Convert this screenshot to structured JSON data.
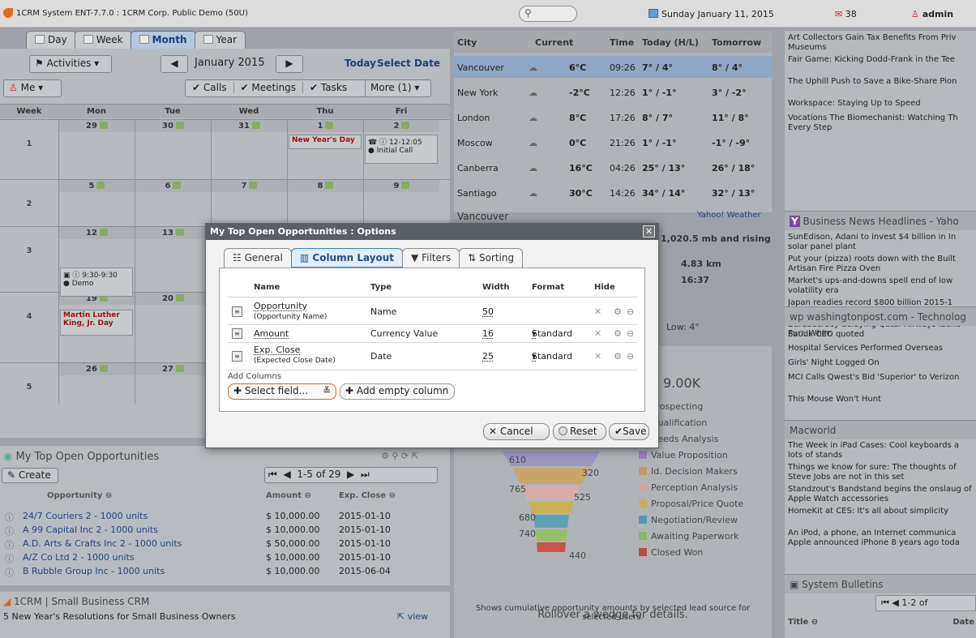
{
  "topbar": {
    "title": "1CRM System ENT-7.7.0 : 1CRM Corp. Public Demo (50U)",
    "date": "Sunday January 11, 2015",
    "mail_count": "38",
    "user": "admin"
  },
  "calendar": {
    "tabs": [
      "Day",
      "Week",
      "Month",
      "Year"
    ],
    "activities_label": "Activities",
    "month_label": "January 2015",
    "today_label": "Today",
    "select_date_label": "Select Date",
    "me_label": "Me",
    "filters": [
      "Calls",
      "Meetings",
      "Tasks"
    ],
    "more_label": "More (1)",
    "headers": [
      "Week",
      "Mon",
      "Tue",
      "Wed",
      "Thu",
      "Fri"
    ],
    "weeks": [
      {
        "num": "1",
        "days": [
          "29",
          "30",
          "31",
          "1",
          "2"
        ]
      },
      {
        "num": "2",
        "days": [
          "5",
          "6",
          "7",
          "8",
          "9"
        ]
      },
      {
        "num": "3",
        "days": [
          "12",
          "13",
          "",
          "",
          ""
        ]
      },
      {
        "num": "4",
        "days": [
          "19",
          "20",
          "",
          "",
          ""
        ]
      },
      {
        "num": "5",
        "days": [
          "26",
          "27",
          "",
          "",
          ""
        ]
      }
    ],
    "events": {
      "new_year": "New Year's Day",
      "call_time": "12-12:05",
      "call_name": "Initial Call",
      "meeting_time": "9:30-9:30",
      "meeting_name": "Demo",
      "mlk": "Martin Luther King, Jr. Day"
    }
  },
  "weather": {
    "headers": [
      "City",
      "Current",
      "Time",
      "Today (H/L)",
      "Tomorrow"
    ],
    "rows": [
      {
        "city": "Vancouver",
        "temp": "6°C",
        "time": "09:26",
        "today": "7° / 4°",
        "tomorrow": "8° / 4°"
      },
      {
        "city": "New York",
        "temp": "-2°C",
        "time": "12:26",
        "today": "1° / -1°",
        "tomorrow": "3° / -2°"
      },
      {
        "city": "London",
        "temp": "8°C",
        "time": "17:26",
        "today": "8° / 7°",
        "tomorrow": "11° / 8°"
      },
      {
        "city": "Moscow",
        "temp": "0°C",
        "time": "21:26",
        "today": "1° / -1°",
        "tomorrow": "-1° / -9°"
      },
      {
        "city": "Canberra",
        "temp": "16°C",
        "time": "04:26",
        "today": "25° / 13°",
        "tomorrow": "26° / 18°"
      },
      {
        "city": "Santiago",
        "temp": "30°C",
        "time": "14:26",
        "today": "34° / 14°",
        "tomorrow": "32° / 13°"
      }
    ],
    "detail_city": "Vancouver",
    "source": "Yahoo! Weather",
    "pressure": "1,020.5 mb and rising",
    "visibility": "4.83 km",
    "sunset": "16:37",
    "low": "Low: 4°"
  },
  "funnel": {
    "total": "9.00K",
    "legend": [
      "Prospecting",
      "Qualification",
      "Needs Analysis",
      "Value Proposition",
      "Id. Decision Makers",
      "Perception Analysis",
      "Proposal/Price Quote",
      "Negotiation/Review",
      "Awaiting Paperwork",
      "Closed Won"
    ],
    "legend_colors": [
      "#b8bcc1",
      "#b8bcc1",
      "#b8bcc1",
      "#9a83b8",
      "#c29a62",
      "#d4a2a2",
      "#c9b04c",
      "#4b9cb0",
      "#8eb85a",
      "#c2483f"
    ],
    "values": [
      "610",
      "320",
      "765",
      "525",
      "680",
      "740",
      "440"
    ],
    "rollover": "Rollover a wedge for details.",
    "caption": "Shows cumulative opportunity amounts by selected lead source for selected users."
  },
  "news": {
    "items_top": [
      "Art Collectors Gain Tax Benefits From Priv Museums",
      "Fair Game: Kicking Dodd-Frank in the Tee",
      "The Uphill Push to Save a Bike-Share Pion",
      "Workspace: Staying Up to Speed",
      "Vocations The Biomechanist: Watching Th Every Step"
    ],
    "business_title": "Business News Headlines - Yaho",
    "business_items": [
      "SunEdison, Adani to invest $4 billion in In solar panel plant",
      "Put your (pizza) roots down with the Built Artisan Fire Pizza Oven",
      "Market's ups-and-downs spell end of low volatility era",
      "Japan readies record $800 billion 2015-1 budget: sources",
      "Bureaucracy delaying Qatar Airways launc Saudi: CEO quoted"
    ],
    "wapo_title": "washingtonpost.com - Technolog",
    "wapo_items": [
      "Purr. Whirr.",
      "Hospital Services Performed Overseas",
      "Girls' Night Logged On",
      "MCI Calls Qwest's Bid 'Superior' to Verizon",
      "This Mouse Won't Hunt"
    ],
    "macworld_title": "Macworld",
    "macworld_items": [
      "The Week in iPad Cases: Cool keyboards a lots of stands",
      "Things we know for sure: The thoughts of Steve Jobs are not in this set",
      "Standzout's Bandstand begins the onslaug of Apple Watch accessories",
      "HomeKit at CES: It's all about simplicity",
      "An iPod, a phone, an Internet communica Apple announced iPhone 8 years ago toda"
    ],
    "bulletins_title": "System Bulletins",
    "bulletins_paging": "1-2 of",
    "bulletins_cols": [
      "Title",
      "Date"
    ]
  },
  "opps": {
    "title": "My Top Open Opportunities",
    "create": "Create",
    "paging": "1-5 of 29",
    "cols": [
      "Opportunity",
      "Amount",
      "Exp. Close"
    ],
    "rows": [
      {
        "name": "24/7 Couriers 2 - 1000 units",
        "amount": "$ 10,000.00",
        "close": "2015-01-10"
      },
      {
        "name": "A 99 Capital Inc 2 - 1000 units",
        "amount": "$ 10,000.00",
        "close": "2015-01-10"
      },
      {
        "name": "A.D. Arts & Crafts Inc 2 - 1000 units",
        "amount": "$ 50,000.00",
        "close": "2015-01-10"
      },
      {
        "name": "A/Z Co Ltd 2 - 1000 units",
        "amount": "$ 10,000.00",
        "close": "2015-01-10"
      },
      {
        "name": "B Rubble Group Inc - 1000 units",
        "amount": "$ 10,000.00",
        "close": "2015-06-04"
      }
    ]
  },
  "crm": {
    "title": "1CRM | Small Business CRM",
    "item": "5 New Year's Resolutions for Small Business Owners",
    "view": "view"
  },
  "modal": {
    "title": "My Top Open Opportunities : Options",
    "tabs": [
      "General",
      "Column Layout",
      "Filters",
      "Sorting"
    ],
    "cols": [
      "Name",
      "Type",
      "Width",
      "Format",
      "Hide"
    ],
    "rows": [
      {
        "name": "Opportunity",
        "sub": "(Opportunity Name)",
        "type": "Name",
        "width": "50",
        "format": ""
      },
      {
        "name": "Amount",
        "sub": "",
        "type": "Currency Value",
        "width": "16",
        "format": "Standard"
      },
      {
        "name": "Exp. Close",
        "sub": "(Expected Close Date)",
        "type": "Date",
        "width": "25",
        "format": "Standard"
      }
    ],
    "add_columns": "Add Columns",
    "select_field": "Select field...",
    "add_empty": "Add empty column",
    "cancel": "Cancel",
    "reset": "Reset",
    "save": "Save"
  }
}
